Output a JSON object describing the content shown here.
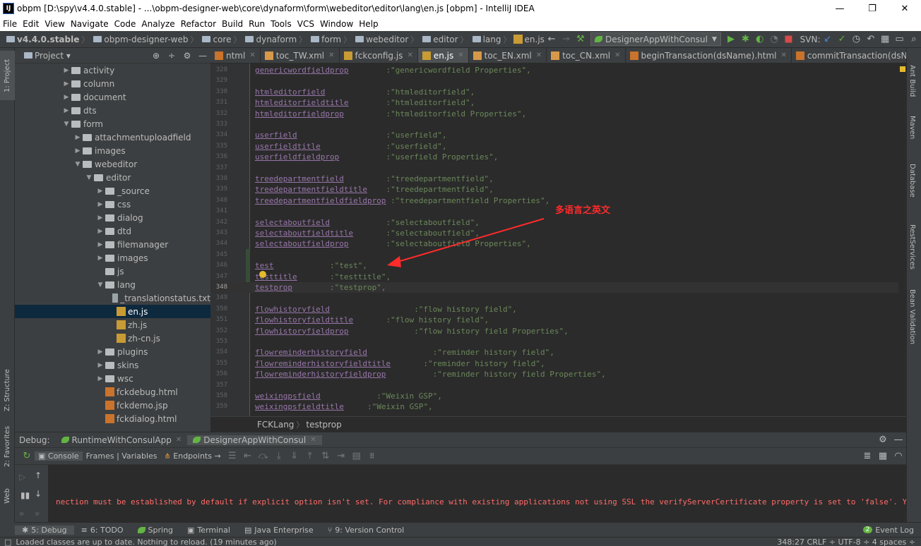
{
  "window": {
    "icon": "IJ",
    "title": "obpm [D:\\spy\\v4.4.0.stable] - ...\\obpm-designer-web\\core\\dynaform\\form\\webeditor\\editor\\lang\\en.js [obpm] - IntelliJ IDEA",
    "min": "—",
    "max": "❐",
    "close": "✕"
  },
  "menu": [
    "File",
    "Edit",
    "View",
    "Navigate",
    "Code",
    "Analyze",
    "Refactor",
    "Build",
    "Run",
    "Tools",
    "VCS",
    "Window",
    "Help"
  ],
  "nav": {
    "crumbs": [
      "v4.4.0.stable",
      "obpm-designer-web",
      "core",
      "dynaform",
      "form",
      "webeditor",
      "editor",
      "lang",
      "en.js"
    ],
    "run_config": "DesignerAppWithConsul",
    "svn_label": "SVN:"
  },
  "left_strip": {
    "project": "1: Project",
    "structure": "Z: Structure",
    "favorites": "2: Favorites",
    "web": "Web"
  },
  "right_strip": {
    "ant": "Ant Build",
    "maven": "Maven",
    "database": "Database",
    "rest": "RestServices",
    "bean": "Bean Validation"
  },
  "project": {
    "title": "Project",
    "tree": [
      {
        "indent": 4,
        "arrow": "▶",
        "icon": "folder",
        "label": "activity"
      },
      {
        "indent": 4,
        "arrow": "▶",
        "icon": "folder",
        "label": "column"
      },
      {
        "indent": 4,
        "arrow": "▶",
        "icon": "folder",
        "label": "document"
      },
      {
        "indent": 4,
        "arrow": "▶",
        "icon": "folder",
        "label": "dts"
      },
      {
        "indent": 4,
        "arrow": "▼",
        "icon": "folder",
        "label": "form"
      },
      {
        "indent": 5,
        "arrow": "▶",
        "icon": "folder",
        "label": "attachmentuploadfield"
      },
      {
        "indent": 5,
        "arrow": "▶",
        "icon": "folder",
        "label": "images"
      },
      {
        "indent": 5,
        "arrow": "▼",
        "icon": "folder",
        "label": "webeditor"
      },
      {
        "indent": 6,
        "arrow": "▼",
        "icon": "folder",
        "label": "editor"
      },
      {
        "indent": 7,
        "arrow": "▶",
        "icon": "folder",
        "label": "_source"
      },
      {
        "indent": 7,
        "arrow": "▶",
        "icon": "folder",
        "label": "css"
      },
      {
        "indent": 7,
        "arrow": "▶",
        "icon": "folder",
        "label": "dialog"
      },
      {
        "indent": 7,
        "arrow": "▶",
        "icon": "folder",
        "label": "dtd"
      },
      {
        "indent": 7,
        "arrow": "▶",
        "icon": "folder",
        "label": "filemanager"
      },
      {
        "indent": 7,
        "arrow": "▶",
        "icon": "folder",
        "label": "images"
      },
      {
        "indent": 7,
        "arrow": "",
        "icon": "folder",
        "label": "js"
      },
      {
        "indent": 7,
        "arrow": "▼",
        "icon": "folder",
        "label": "lang"
      },
      {
        "indent": 8,
        "arrow": "",
        "icon": "txt",
        "label": "_translationstatus.txt"
      },
      {
        "indent": 8,
        "arrow": "",
        "icon": "js",
        "label": "en.js",
        "selected": true
      },
      {
        "indent": 8,
        "arrow": "",
        "icon": "js",
        "label": "zh.js"
      },
      {
        "indent": 8,
        "arrow": "",
        "icon": "js",
        "label": "zh-cn.js"
      },
      {
        "indent": 7,
        "arrow": "▶",
        "icon": "folder",
        "label": "plugins"
      },
      {
        "indent": 7,
        "arrow": "▶",
        "icon": "folder",
        "label": "skins"
      },
      {
        "indent": 7,
        "arrow": "▶",
        "icon": "folder",
        "label": "wsc"
      },
      {
        "indent": 7,
        "arrow": "",
        "icon": "html",
        "label": "fckdebug.html"
      },
      {
        "indent": 7,
        "arrow": "",
        "icon": "html",
        "label": "fckdemo.jsp"
      },
      {
        "indent": 7,
        "arrow": "",
        "icon": "html",
        "label": "fckdialog.html"
      }
    ]
  },
  "tabs": [
    {
      "label": "ntml",
      "type": "htm",
      "active": false
    },
    {
      "label": "toc_TW.xml",
      "type": "xml",
      "active": false
    },
    {
      "label": "fckconfig.js",
      "type": "js",
      "active": false
    },
    {
      "label": "en.js",
      "type": "js",
      "active": true
    },
    {
      "label": "toc_EN.xml",
      "type": "xml",
      "active": false
    },
    {
      "label": "toc_CN.xml",
      "type": "xml",
      "active": false
    },
    {
      "label": "beginTransaction(dsName).html",
      "type": "htm",
      "active": false
    },
    {
      "label": "commitTransaction(dsName).html",
      "type": "htm",
      "active": false
    }
  ],
  "tabs_overflow": "▾≡3",
  "editor": {
    "lines": [
      {
        "n": "328",
        "key": "genericwordfieldprop",
        "pad": "        ",
        "val": ":\"genericwordfield Properties\","
      },
      {
        "n": "329",
        "key": "",
        "pad": "",
        "val": ""
      },
      {
        "n": "330",
        "key": "htmleditorfield",
        "pad": "             ",
        "val": ":\"htmleditorfield\","
      },
      {
        "n": "331",
        "key": "htmleditorfieldtitle",
        "pad": "        ",
        "val": ":\"htmleditorfield\","
      },
      {
        "n": "332",
        "key": "htmleditorfieldprop",
        "pad": "         ",
        "val": ":\"htmleditorfield Properties\","
      },
      {
        "n": "333",
        "key": "",
        "pad": "",
        "val": ""
      },
      {
        "n": "334",
        "key": "userfield",
        "pad": "                   ",
        "val": ":\"userfield\","
      },
      {
        "n": "335",
        "key": "userfieldtitle",
        "pad": "              ",
        "val": ":\"userfield\","
      },
      {
        "n": "336",
        "key": "userfieldfieldprop",
        "pad": "          ",
        "val": ":\"userfield Properties\","
      },
      {
        "n": "337",
        "key": "",
        "pad": "",
        "val": ""
      },
      {
        "n": "338",
        "key": "treedepartmentfield",
        "pad": "         ",
        "val": ":\"treedepartmentfield\","
      },
      {
        "n": "339",
        "key": "treedepartmentfieldtitle",
        "pad": "    ",
        "val": ":\"treedepartmentfield\","
      },
      {
        "n": "340",
        "key": "treedepartmentfieldfieldprop",
        "pad": " ",
        "val": ":\"treedepartmentfield Properties\","
      },
      {
        "n": "341",
        "key": "",
        "pad": "",
        "val": ""
      },
      {
        "n": "342",
        "key": "selectaboutfield",
        "pad": "            ",
        "val": ":\"selectaboutfield\","
      },
      {
        "n": "343",
        "key": "selectaboutfieldtitle",
        "pad": "       ",
        "val": ":\"selectaboutfield\","
      },
      {
        "n": "344",
        "key": "selectaboutfieldprop",
        "pad": "        ",
        "val": ":\"selectaboutfield Properties\","
      },
      {
        "n": "345",
        "key": "",
        "pad": "",
        "val": ""
      },
      {
        "n": "346",
        "key": "test",
        "pad": "            ",
        "val": ":\"test\","
      },
      {
        "n": "347",
        "key": "testtitle",
        "pad": "       ",
        "val": ":\"testtitle\","
      },
      {
        "n": "348",
        "key": "testprop",
        "pad": "        ",
        "val": ":\"testprop\",",
        "current": true
      },
      {
        "n": "349",
        "key": "",
        "pad": "",
        "val": ""
      },
      {
        "n": "350",
        "key": "flowhistoryfield",
        "pad": "                  ",
        "val": ":\"flow history field\","
      },
      {
        "n": "351",
        "key": "flowhistoryfieldtitle",
        "pad": "       ",
        "val": ":\"flow history field\","
      },
      {
        "n": "352",
        "key": "flowhistoryfieldprop",
        "pad": "              ",
        "val": ":\"flow history field Properties\","
      },
      {
        "n": "353",
        "key": "",
        "pad": "",
        "val": ""
      },
      {
        "n": "354",
        "key": "flowreminderhistoryfield",
        "pad": "              ",
        "val": ":\"reminder history field\","
      },
      {
        "n": "355",
        "key": "flowreminderhistoryfieldtitle",
        "pad": "       ",
        "val": ":\"reminder history field\","
      },
      {
        "n": "356",
        "key": "flowreminderhistoryfieldprop",
        "pad": "          ",
        "val": ":\"reminder history field Properties\","
      },
      {
        "n": "357",
        "key": "",
        "pad": "",
        "val": ""
      },
      {
        "n": "358",
        "key": "weixingpsfield",
        "pad": "            ",
        "val": ":\"Weixin GSP\","
      },
      {
        "n": "359",
        "key": "weixingpsfieldtitle",
        "pad": "     ",
        "val": ":\"Weixin GSP\","
      }
    ],
    "annotation": "多语言之英文"
  },
  "breadcrumb": {
    "a": "FCKLang",
    "b": "testprop"
  },
  "debug": {
    "label": "Debug:",
    "sessions": [
      "RuntimeWithConsulApp",
      "DesignerAppWithConsul"
    ],
    "toolbar": [
      "Console",
      "Frames | Variables",
      "Endpoints"
    ],
    "error_text": "nection must be established by default if explicit option isn't set. For compliance with existing applications not using SSL the verifyServerCertificate property is set to 'false'. You need"
  },
  "bottom_tabs": [
    "5: Debug",
    "6: TODO",
    "Spring",
    "Terminal",
    "Java Enterprise",
    "9: Version Control"
  ],
  "event_log": {
    "count": "2",
    "label": "Event Log"
  },
  "status": {
    "message": "Loaded classes are up to date. Nothing to reload. (19 minutes ago)",
    "right": "348:27  CRLF ÷  UTF-8 ÷  4 spaces ÷"
  },
  "colors": {
    "keyword": "#9876aa",
    "string": "#6a8759",
    "error": "#ff6b68",
    "annotation": "#ff2b2b"
  }
}
